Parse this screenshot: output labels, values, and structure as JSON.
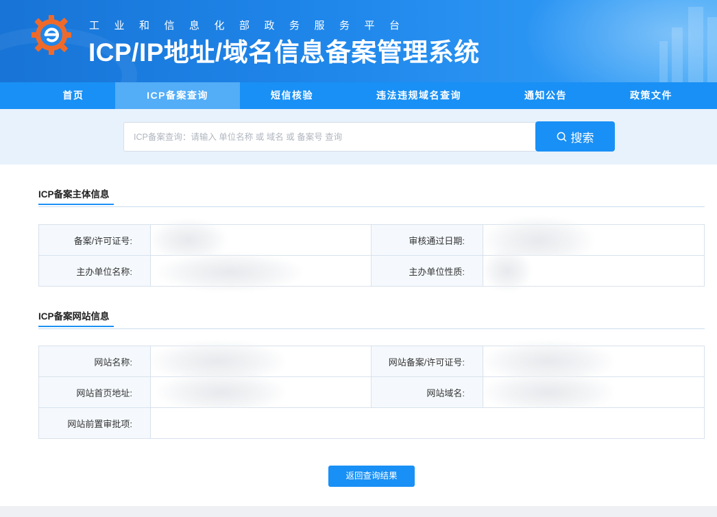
{
  "header": {
    "subtitle": "工业和信息化部政务服务平台",
    "title": "ICP/IP地址/域名信息备案管理系统",
    "logo_icon": "gear-e-logo",
    "brand_color": "#1990f5"
  },
  "nav": {
    "items": [
      {
        "label": "首页",
        "active": false
      },
      {
        "label": "ICP备案查询",
        "active": true
      },
      {
        "label": "短信核验",
        "active": false
      },
      {
        "label": "违法违规域名查询",
        "active": false
      },
      {
        "label": "通知公告",
        "active": false
      },
      {
        "label": "政策文件",
        "active": false
      }
    ]
  },
  "search": {
    "placeholder": "ICP备案查询：请输入 单位名称 或 域名 或 备案号 查询",
    "value": "",
    "button_label": "搜索",
    "button_icon": "search-icon"
  },
  "subject": {
    "title": "ICP备案主体信息",
    "rows": [
      [
        {
          "label": "备案/许可证号:",
          "value": ""
        },
        {
          "label": "审核通过日期:",
          "value": ""
        }
      ],
      [
        {
          "label": "主办单位名称:",
          "value": ""
        },
        {
          "label": "主办单位性质:",
          "value": ""
        }
      ]
    ]
  },
  "website": {
    "title": "ICP备案网站信息",
    "rows": [
      [
        {
          "label": "网站名称:",
          "value": ""
        },
        {
          "label": "网站备案/许可证号:",
          "value": ""
        }
      ],
      [
        {
          "label": "网站首页地址:",
          "value": ""
        },
        {
          "label": "网站域名:",
          "value": ""
        }
      ],
      [
        {
          "label": "网站前置审批项:",
          "value": ""
        }
      ]
    ]
  },
  "actions": {
    "back_label": "返回查询结果"
  }
}
